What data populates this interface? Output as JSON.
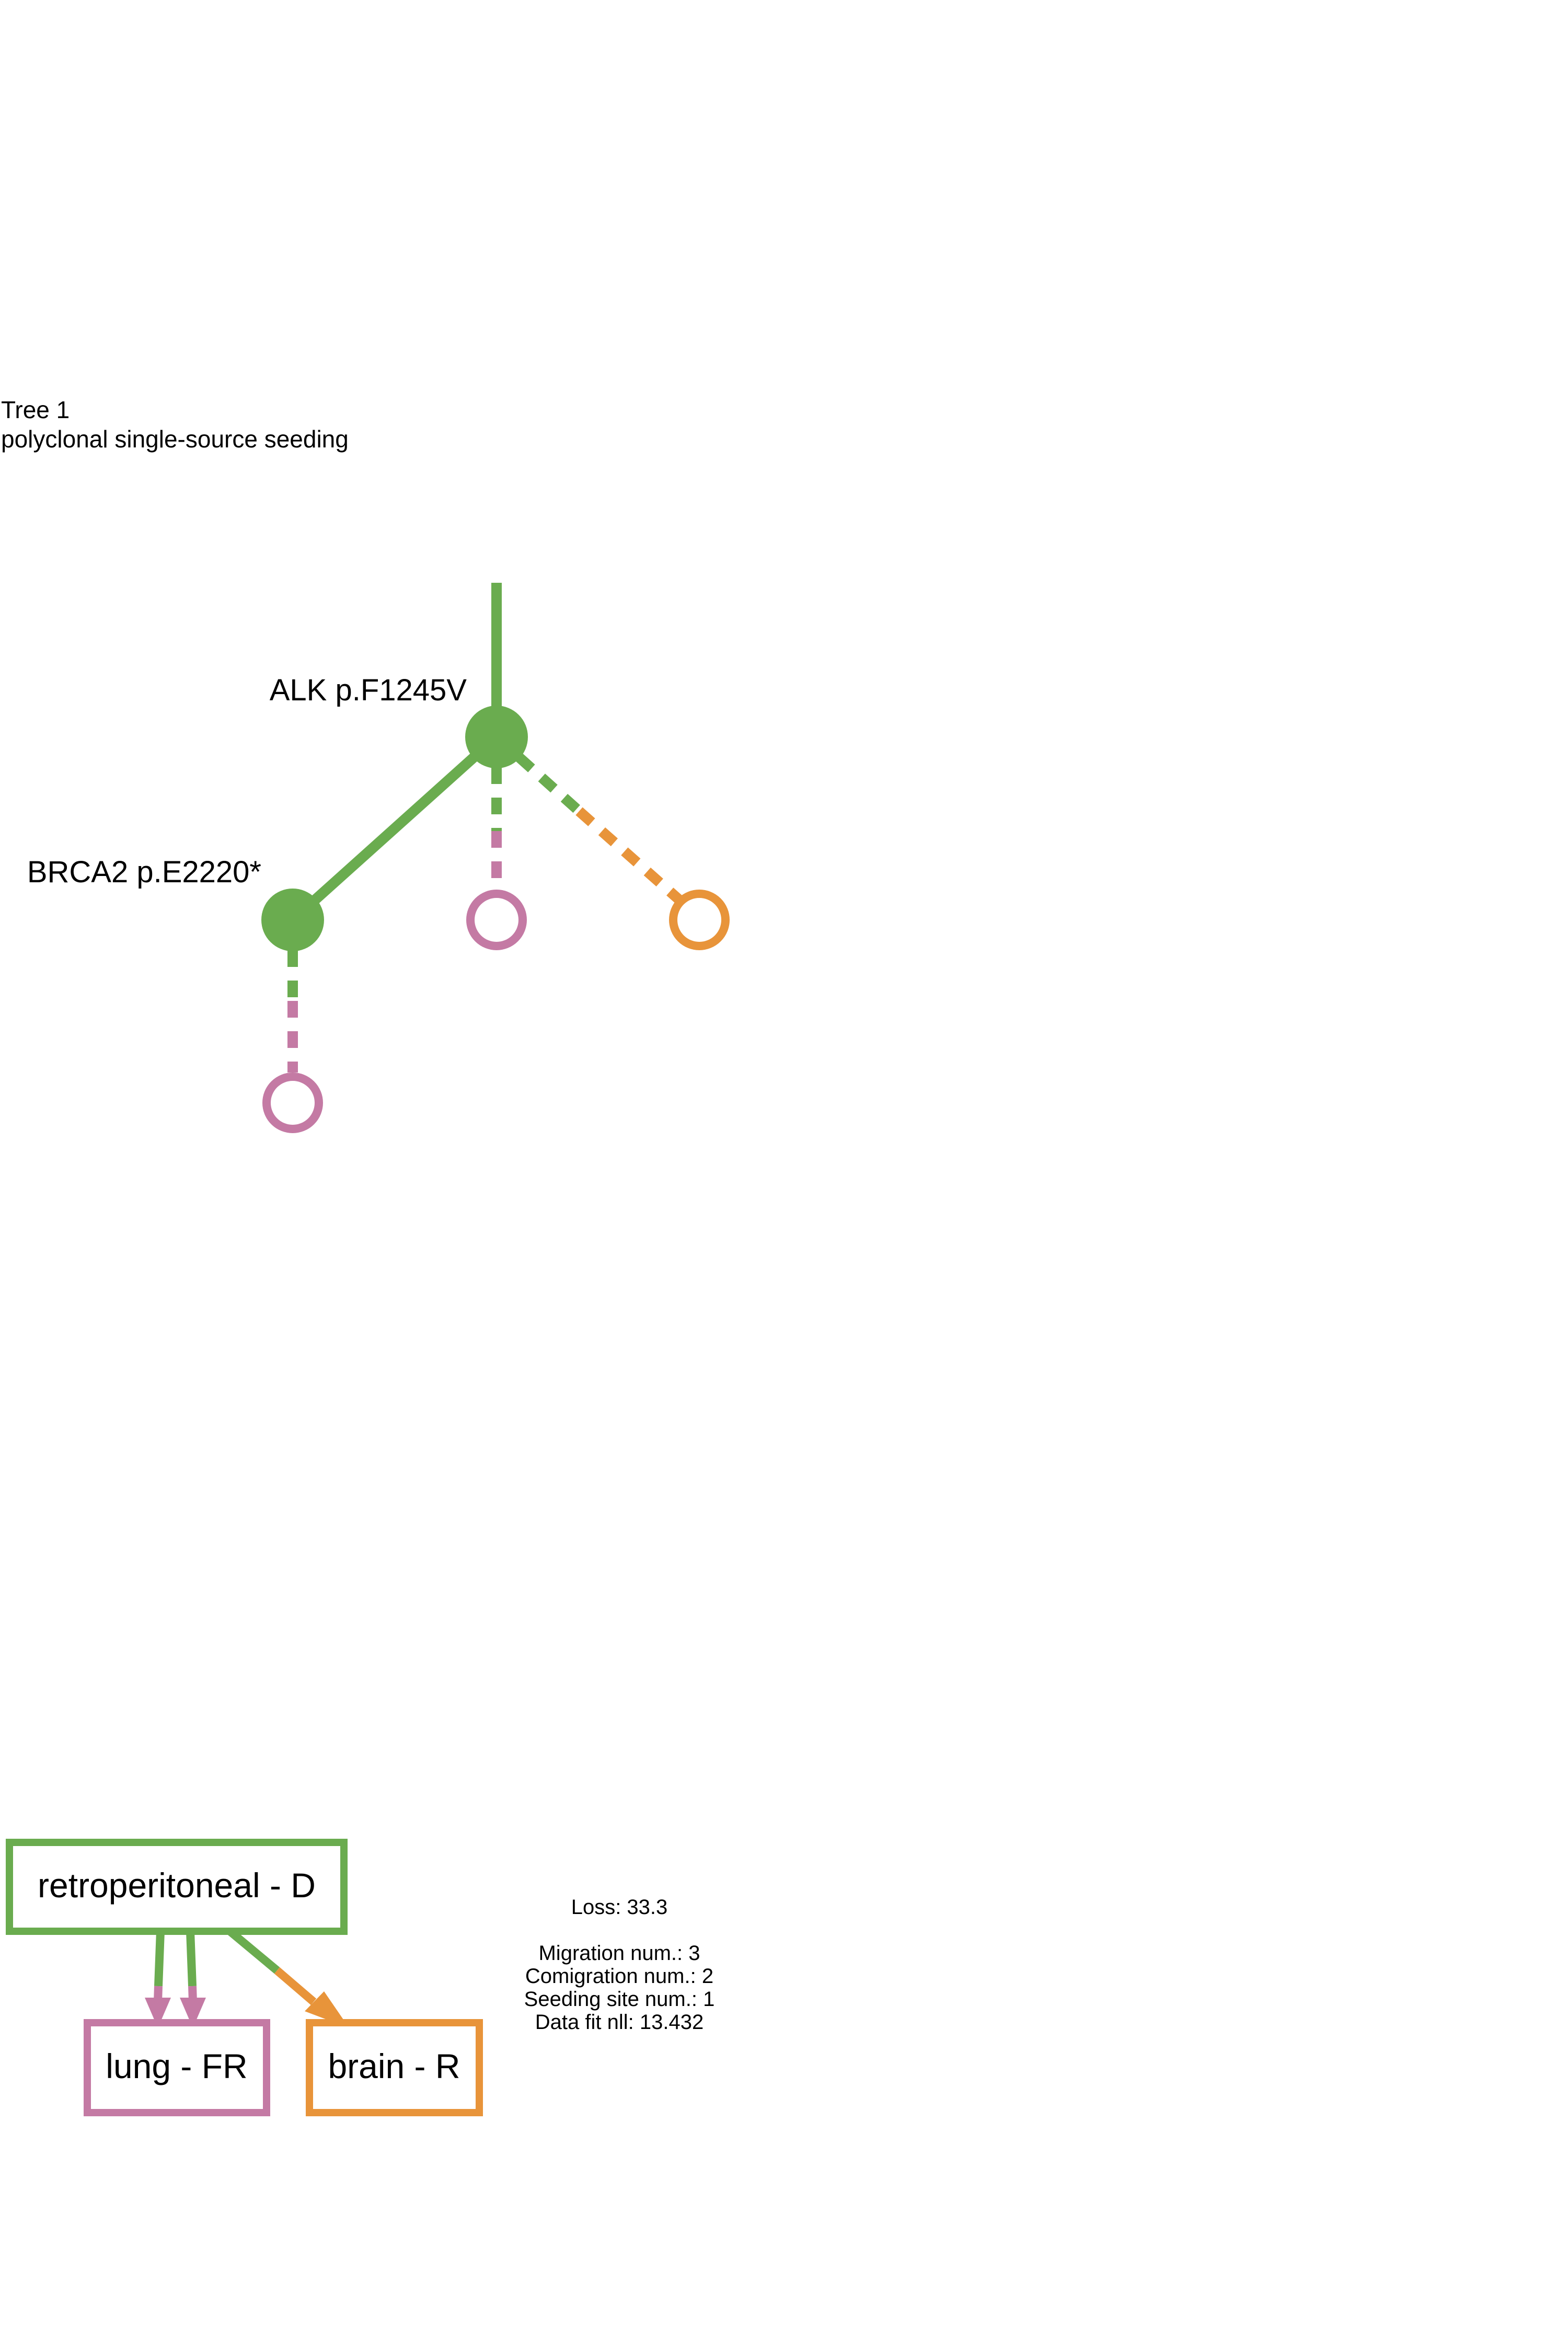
{
  "header": {
    "title": "Tree 1",
    "subtitle": "polyclonal single-source seeding"
  },
  "colors": {
    "retroperitoneal": "#6aac4f",
    "lung": "#c47aa4",
    "brain": "#e8943a"
  },
  "tree": {
    "mutations": {
      "alk": "ALK p.F1245V",
      "brca2": "BRCA2 p.E2220*"
    }
  },
  "migration_graph": {
    "sites": {
      "primary": "retroperitoneal - D",
      "lung": "lung - FR",
      "brain": "brain - R"
    }
  },
  "stats": {
    "loss": "Loss: 33.3",
    "migration_num": "Migration num.: 3",
    "comigration_num": "Comigration num.: 2",
    "seeding_site_num": "Seeding site num.: 1",
    "data_fit_nll": "Data fit nll: 13.432"
  }
}
